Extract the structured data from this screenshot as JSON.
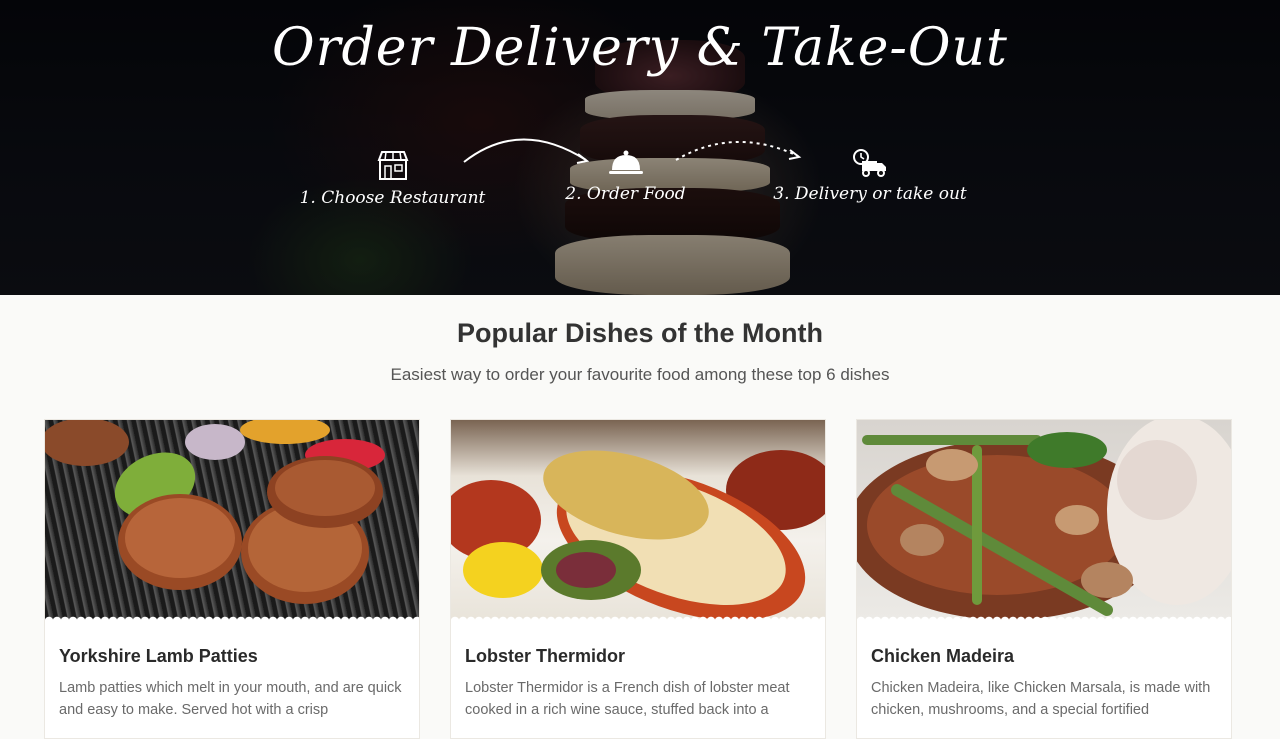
{
  "hero": {
    "title": "Order Delivery & Take-Out",
    "steps": [
      {
        "label": "1. Choose Restaurant",
        "icon": "store-icon"
      },
      {
        "label": "2. Order Food",
        "icon": "food-cloche-icon"
      },
      {
        "label": "3. Delivery or take out",
        "icon": "delivery-truck-icon"
      }
    ]
  },
  "popular": {
    "title": "Popular Dishes of the Month",
    "subtitle": "Easiest way to order your favourite food among these top 6 dishes",
    "dishes": [
      {
        "name": "Yorkshire Lamb Patties",
        "description": "Lamb patties which melt in your mouth, and are quick and easy to make. Served hot with a crisp"
      },
      {
        "name": "Lobster Thermidor",
        "description": "Lobster Thermidor is a French dish of lobster meat cooked in a rich wine sauce, stuffed back into a"
      },
      {
        "name": "Chicken Madeira",
        "description": "Chicken Madeira, like Chicken Marsala, is made with chicken, mushrooms, and a special fortified"
      }
    ]
  },
  "colors": {
    "hero_bg": "#0b0c12",
    "page_bg": "#fafaf8",
    "card_bg": "#ffffff",
    "title_text": "#333333",
    "desc_text": "#6a6a6a"
  }
}
